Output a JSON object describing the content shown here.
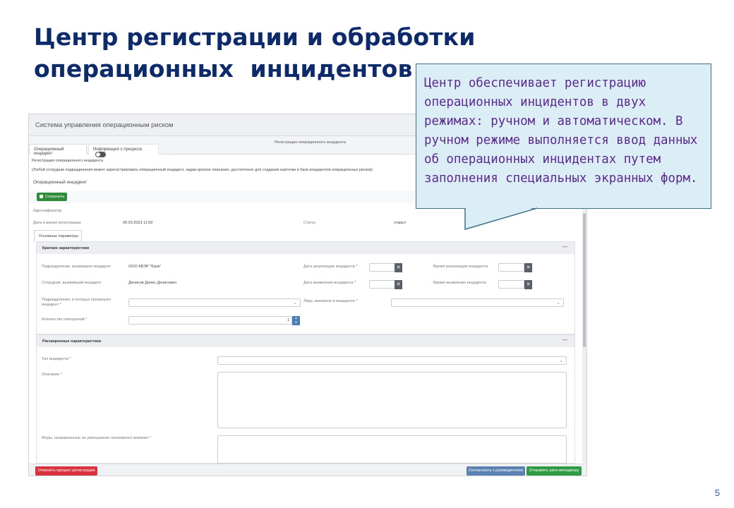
{
  "slide": {
    "title_line1": "Центр регистрации и обработки",
    "title_line2": "операционных  инцидентов",
    "page_number": "5"
  },
  "callout": {
    "text": "Центр обеспечивает регистрацию операционных инцидентов в двух режимах: ручном и автоматическом. В ручном режиме выполняется ввод данных об операционных инцидентах путем заполнения специальных экранных форм."
  },
  "app": {
    "title": "Система управления операционным риском",
    "form_caption": "Регистрация операционного инцидента",
    "tabs": [
      "Операционный инцидент",
      "Информация о процессе"
    ],
    "breadcrumb": "Регистрация операционного инцидента",
    "hint": "(Любой сотрудник подразделения может зарегистрировать операционный инцидент, задав краткое описание, достаточное для создания карточки в базе инцидентов операционных рисков)",
    "section_title": "Операционный инцидент",
    "save_label": "Сохранить",
    "id_label": "Идентификатор",
    "reg_date_label": "Дата и время регистрации",
    "reg_date_value": "00.03.2023 11:50",
    "status_label": "Статус",
    "status_value": "открыт",
    "params_tab": "Основные параметры"
  },
  "brief": {
    "header": "Краткие характеристики",
    "dept_label": "Подразделение, выявившее инцидент",
    "dept_value": "ООО КБЭР \"Банк\"",
    "employee_label": "Сотрудник, выявивший инцидент",
    "employee_value": "Денисов Денис Денисович",
    "affected_label": "Подразделения, в которых произошел инцидент *",
    "repeats_label": "Количество повторений *",
    "repeats_value": "1",
    "realize_date_label": "Дата реализации инцидента *",
    "realize_time_label": "Время реализации инцидента",
    "detect_date_label": "Дата выявления инцидента *",
    "detect_time_label": "Время выявления инцидента",
    "persons_label": "Лицо, виновное в инциденте *"
  },
  "extended": {
    "header": "Расширенные характеристики",
    "type_label": "Тип инцидента *",
    "description_label": "Описание *",
    "measures_label": "Меры, направленные на уменьшение негативного влияния *"
  },
  "footer": {
    "cancel_label": "Отменить процесс регистрации",
    "approve_label": "Согласовать с руководителем",
    "send_label": "Отправить риск-менеджеру"
  },
  "colors": {
    "title": "#0d2a6b",
    "callout_bg": "#dbeef6",
    "callout_text": "#5b2a8c",
    "save": "#2e8b3a",
    "cancel": "#d9343e",
    "approve": "#5b80b2",
    "send": "#2f9a44"
  }
}
